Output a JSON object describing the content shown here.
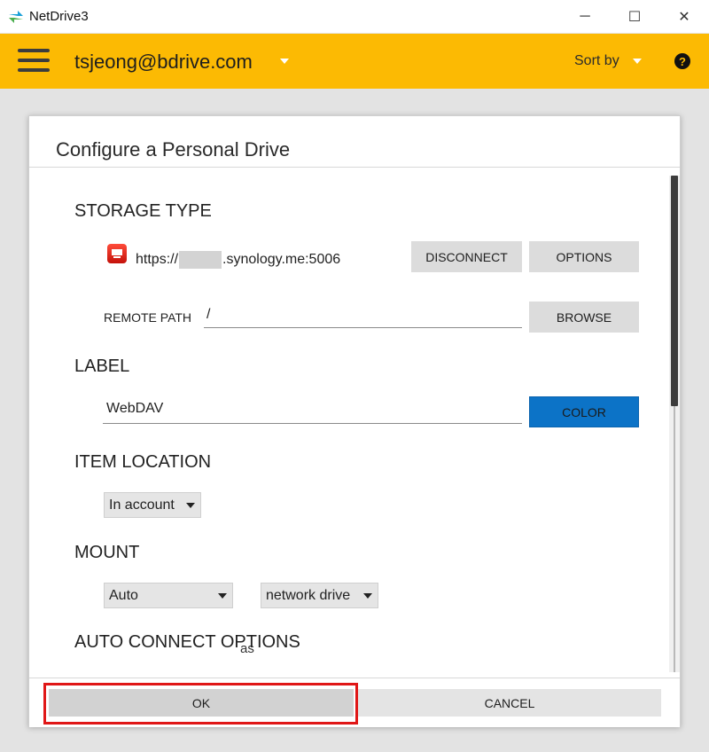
{
  "window": {
    "title": "NetDrive3",
    "controls": {
      "minimize": "─",
      "maximize": "☐",
      "close": "✕"
    }
  },
  "appbar": {
    "account": "tsjeong@bdrive.com",
    "sort_label": "Sort by",
    "help": "?",
    "color": "#fcba03"
  },
  "dialog": {
    "title": "Configure a Personal Drive",
    "sections": {
      "storage_type": "STORAGE TYPE",
      "label": "LABEL",
      "item_location": "ITEM LOCATION",
      "mount": "MOUNT",
      "auto_connect": "AUTO CONNECT OPTIONS"
    },
    "storage": {
      "url_prefix": "https://",
      "url_suffix": ".synology.me:5006",
      "disconnect_label": "DISCONNECT",
      "options_label": "OPTIONS",
      "remote_path_label": "REMOTE PATH",
      "remote_path_value": "/",
      "browse_label": "BROWSE"
    },
    "label": {
      "value": "WebDAV",
      "color_button": "COLOR",
      "color_button_color": "#0c73c7"
    },
    "item_location": {
      "selected": "In account"
    },
    "mount": {
      "mode": "Auto",
      "as_text": "as",
      "type": "network drive"
    },
    "footer": {
      "ok_label": "OK",
      "cancel_label": "CANCEL",
      "highlight_color": "#e01717"
    }
  }
}
